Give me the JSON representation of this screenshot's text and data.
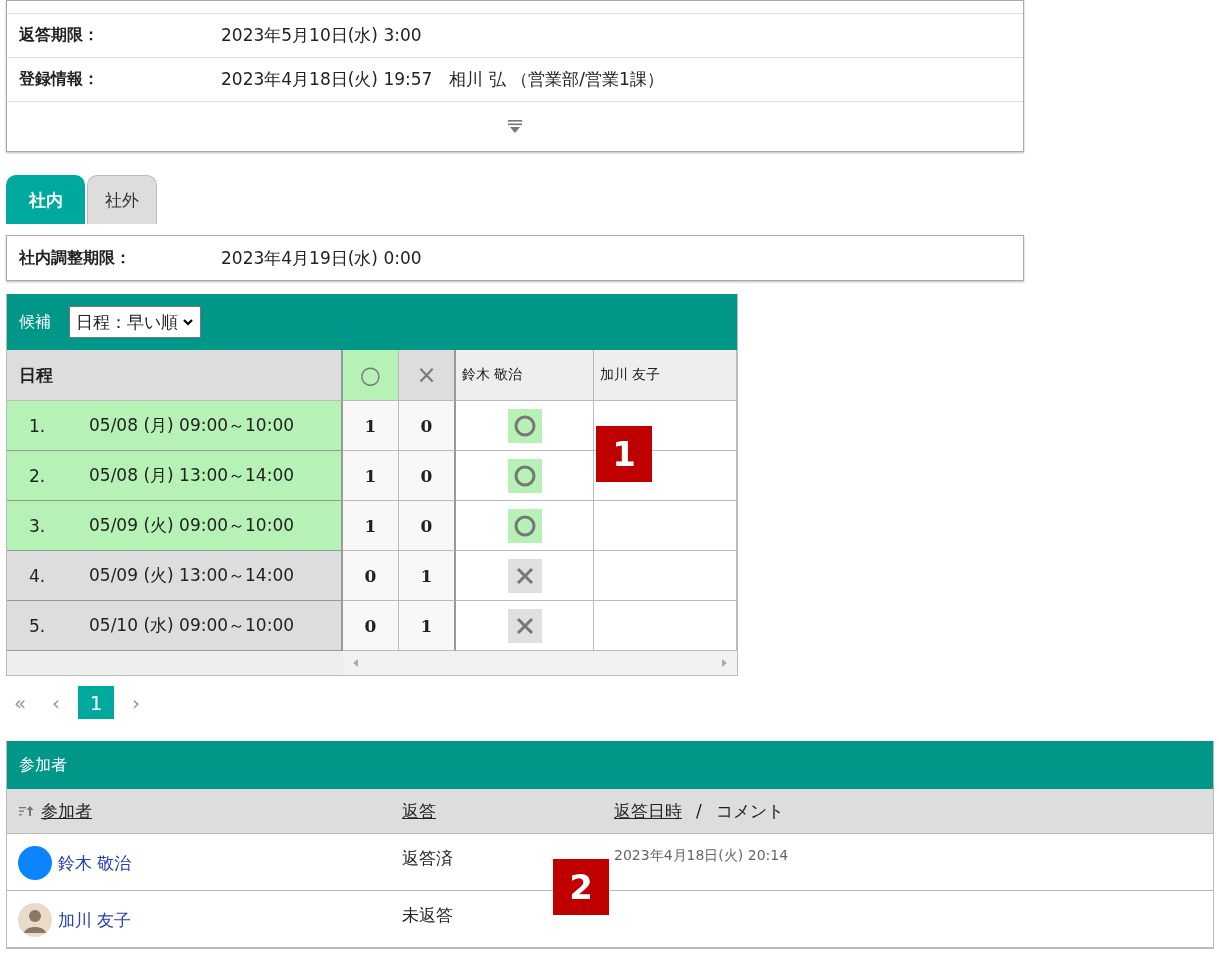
{
  "info_rows": [
    {
      "label": "返答期限：",
      "value": "2023年5月10日(水) 3:00"
    },
    {
      "label": "登録情報：",
      "value": "2023年4月18日(火) 19:57　相川 弘 （営業部/営業1課）"
    }
  ],
  "tabs": [
    {
      "label": "社内",
      "selected": true
    },
    {
      "label": "社外",
      "selected": false
    }
  ],
  "deadline": {
    "label": "社内調整期限：",
    "value": "2023年4月19日(水) 0:00"
  },
  "candidates": {
    "title": "候補",
    "sort": {
      "value": "日程：早い順"
    },
    "columns": [
      {
        "label": "日程",
        "kind": "date"
      },
      {
        "label": "○",
        "kind": "ok"
      },
      {
        "label": "×",
        "kind": "ng"
      },
      {
        "label": "鈴木 敬治",
        "kind": "person"
      },
      {
        "label": "加川 友子",
        "kind": "person"
      }
    ],
    "rows": [
      {
        "no": "1.",
        "date": "05/08 (月) 09:00～10:00",
        "ok": "1",
        "ng": "0",
        "highlighted": true,
        "answers": [
          {
            "kind": "ok"
          }
        ]
      },
      {
        "no": "2.",
        "date": "05/08 (月) 13:00～14:00",
        "ok": "1",
        "ng": "0",
        "highlighted": true,
        "answers": [
          {
            "kind": "ok"
          }
        ]
      },
      {
        "no": "3.",
        "date": "05/09 (火) 09:00～10:00",
        "ok": "1",
        "ng": "0",
        "highlighted": true,
        "answers": [
          {
            "kind": "ok"
          }
        ]
      },
      {
        "no": "4.",
        "date": "05/09 (火) 13:00～14:00",
        "ok": "0",
        "ng": "1",
        "highlighted": false,
        "answers": [
          {
            "kind": "ng"
          }
        ]
      },
      {
        "no": "5.",
        "date": "05/10 (水) 09:00～10:00",
        "ok": "0",
        "ng": "1",
        "highlighted": false,
        "answers": [
          {
            "kind": "ng"
          }
        ]
      }
    ]
  },
  "pagination": [
    {
      "label": "«",
      "selected": false
    },
    {
      "label": "‹",
      "selected": false
    },
    {
      "label": "1",
      "selected": true
    },
    {
      "label": "›",
      "selected": false
    }
  ],
  "participants": {
    "title": "参加者",
    "columns": [
      "参加者",
      "返答",
      "返答日時",
      "/",
      "コメント"
    ],
    "rows": [
      {
        "name": "鈴木 敬治",
        "avatar": {
          "kind": "circle"
        },
        "reply": "返答済",
        "replied_at": "2023年4月18日(火) 20:14"
      },
      {
        "name": "加川 友子",
        "avatar": {
          "kind": "photo"
        },
        "reply": "未返答"
      }
    ]
  },
  "callouts": [
    "1",
    "2"
  ]
}
